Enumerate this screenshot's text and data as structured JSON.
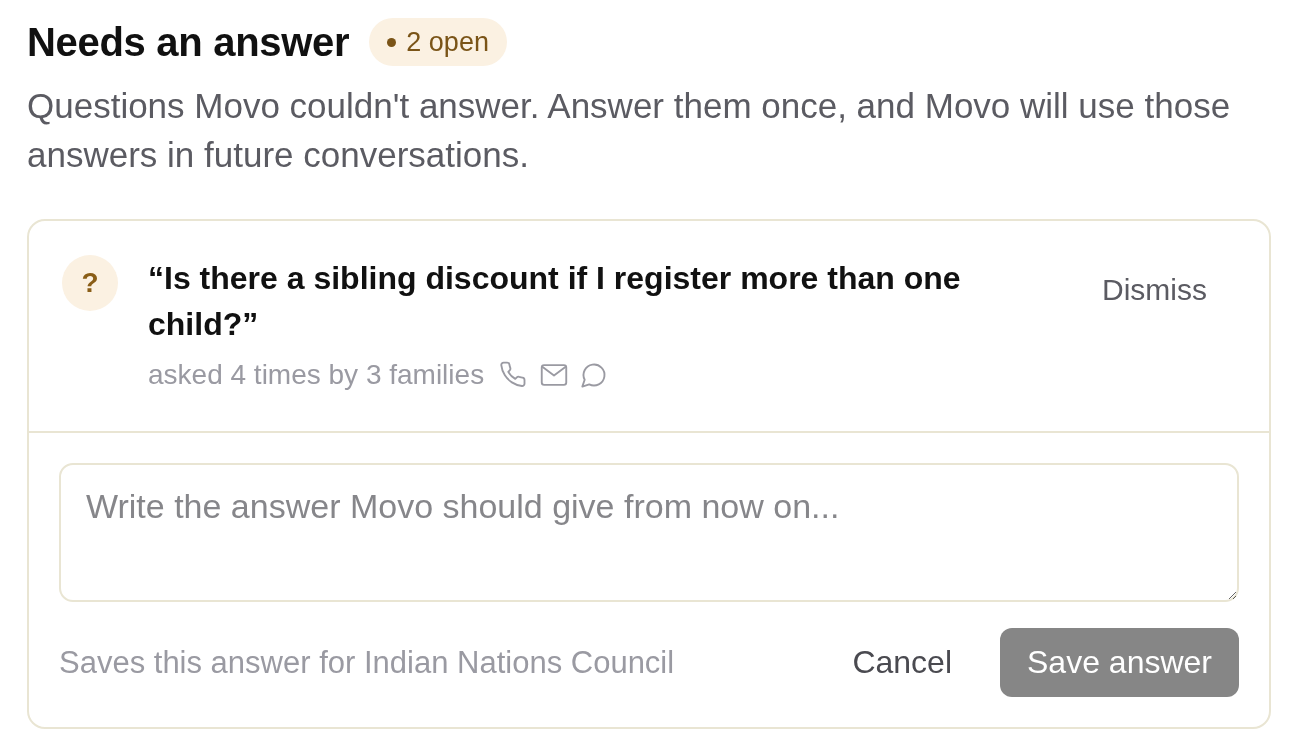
{
  "header": {
    "title": "Needs an answer",
    "badge": {
      "label": "2 open"
    },
    "description": "Questions Movo couldn't answer. Answer them once, and Movo will use those answers in future conversations."
  },
  "questions": [
    {
      "icon": "?",
      "question": "“Is there a sibling discount if I register more than one child?”",
      "meta": "asked 4 times by 3 families",
      "channels": [
        {
          "kind": "phone"
        },
        {
          "kind": "email"
        },
        {
          "kind": "chat"
        }
      ],
      "dismiss": "Dismiss",
      "answer": {
        "placeholder": "Write the answer Movo should give from now on..."
      },
      "footnote": "Saves this answer for Indian Nations Council",
      "cancel": "Cancel",
      "save": {
        "label": "Save answer",
        "disabled": true
      }
    }
  ]
}
